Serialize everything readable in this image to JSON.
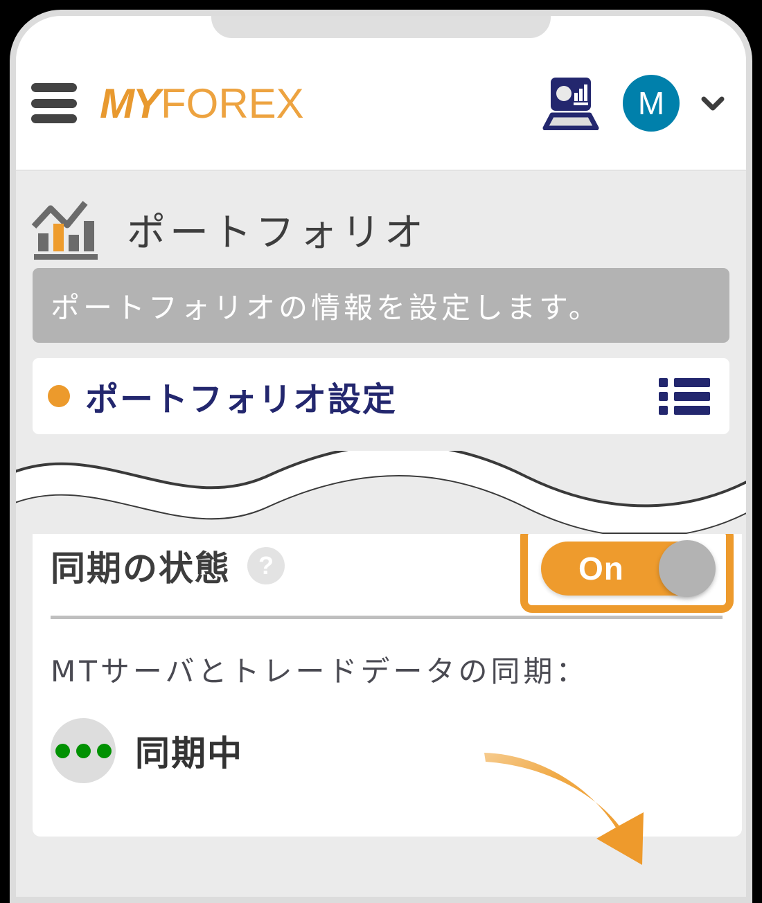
{
  "header": {
    "menu_icon": "hamburger-menu-icon",
    "logo_bold": "MY",
    "logo_light": "FOREX",
    "terminal_icon": "laptop-chart-icon",
    "avatar_initial": "M",
    "chevron_icon": "chevron-down-icon"
  },
  "portfolio": {
    "icon": "bar-chart-icon",
    "title": "ポートフォリオ",
    "description": "ポートフォリオの情報を設定します。",
    "settings": {
      "bullet_color": "#ec9a2c",
      "label": "ポートフォリオ設定",
      "list_icon": "list-bullets-icon"
    }
  },
  "sync": {
    "heading": "同期の状態",
    "help_icon_label": "?",
    "subtitle": "MTサーバとトレードデータの同期：",
    "status_icon": "three-green-dots-icon",
    "status_label": "同期中",
    "toggle": {
      "state_label": "On",
      "is_on": true,
      "highlight_color": "#ed9a2c",
      "track_color": "#ee9b2d",
      "knob_color": "#b3b3b3"
    },
    "callout_arrow": "curved-orange-arrow"
  },
  "colors": {
    "brand_orange": "#e8992f",
    "brand_navy": "#23276e",
    "avatar_teal": "#0080ab",
    "page_background": "#ebebeb",
    "status_green": "#019102"
  }
}
